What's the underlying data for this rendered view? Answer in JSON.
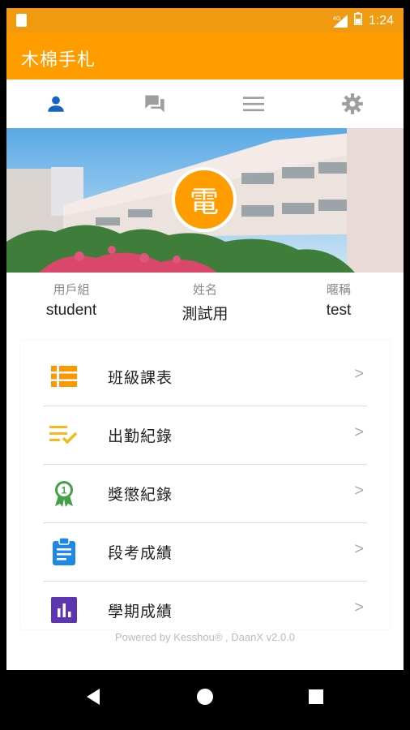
{
  "status_bar": {
    "network": "4G",
    "time": "1:24"
  },
  "app": {
    "title": "木棉手札"
  },
  "tabs": [
    {
      "name": "person-icon",
      "active": true
    },
    {
      "name": "chat-icon",
      "active": false
    },
    {
      "name": "menu-icon",
      "active": false
    },
    {
      "name": "gear-icon",
      "active": false
    }
  ],
  "profile": {
    "avatar_char": "電",
    "group_label": "用戶組",
    "group_value": "student",
    "name_label": "姓名",
    "name_value": "測試用",
    "nickname_label": "暱稱",
    "nickname_value": "test"
  },
  "menu": [
    {
      "label": "班級課表",
      "icon": "list-icon",
      "color": "#ff9800",
      "arrow": ">"
    },
    {
      "label": "出勤紀錄",
      "icon": "checklist-icon",
      "color": "#f5b91a",
      "arrow": ">"
    },
    {
      "label": "獎懲紀錄",
      "icon": "award-icon",
      "color": "#43a047",
      "arrow": ">"
    },
    {
      "label": "段考成績",
      "icon": "clipboard-icon",
      "color": "#1e88e5",
      "arrow": ">"
    },
    {
      "label": "學期成績",
      "icon": "bar-chart-icon",
      "color": "#5e35b1",
      "arrow": ">"
    }
  ],
  "footer": "Powered by Kesshou® , DaanX v2.0.0",
  "colors": {
    "accent": "#ff9c00",
    "status_bar": "#f29a0f",
    "tab_active": "#1565c0",
    "tab_inactive": "#9e9e9e"
  }
}
